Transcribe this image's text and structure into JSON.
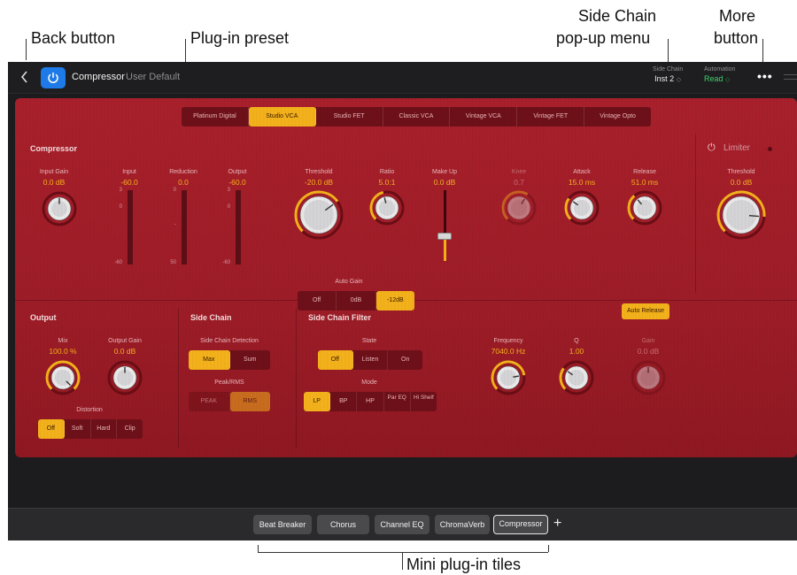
{
  "callouts": {
    "back": "Back button",
    "preset": "Plug-in preset",
    "sidechain_line1": "Side Chain",
    "sidechain_line2": "pop-up menu",
    "more_line1": "More",
    "more_line2": "button",
    "tiles": "Mini plug-in tiles"
  },
  "header": {
    "back_icon": "chevron-left-icon",
    "plugin_name": "Compressor",
    "preset_name": "User Default",
    "side_chain_label": "Side Chain",
    "side_chain_value": "Inst 2",
    "automation_label": "Automation",
    "automation_value": "Read",
    "more_icon": "•••"
  },
  "circuits": [
    "Platinum Digital",
    "Studio VCA",
    "Studio FET",
    "Classic VCA",
    "Vintage VCA",
    "Vintage FET",
    "Vintage Opto"
  ],
  "active_circuit": "Studio VCA",
  "compressor": {
    "title": "Compressor",
    "input_gain": {
      "label": "Input Gain",
      "value": "0.0 dB"
    },
    "input_meter": {
      "label": "Input",
      "value": "-60.0",
      "scale": [
        "3",
        "0",
        "-60"
      ]
    },
    "reduction_meter": {
      "label": "Reduction",
      "value": "0.0",
      "scale": [
        "0",
        "-",
        "50"
      ]
    },
    "output_meter": {
      "label": "Output",
      "value": "-60.0",
      "scale": [
        "3",
        "0",
        "-60"
      ]
    },
    "threshold": {
      "label": "Threshold",
      "value": "-20.0 dB"
    },
    "ratio": {
      "label": "Ratio",
      "value": "5.0:1"
    },
    "makeup": {
      "label": "Make Up",
      "value": "0.0 dB"
    },
    "knee": {
      "label": "Knee",
      "value": "0.7"
    },
    "attack": {
      "label": "Attack",
      "value": "15.0 ms"
    },
    "release": {
      "label": "Release",
      "value": "51.0 ms"
    },
    "auto_release": "Auto Release",
    "auto_gain": {
      "label": "Auto Gain",
      "options": [
        "Off",
        "0dB",
        "-12dB"
      ],
      "active": "-12dB"
    }
  },
  "limiter": {
    "label": "Limiter",
    "threshold": {
      "label": "Threshold",
      "value": "0.0 dB"
    }
  },
  "output": {
    "title": "Output",
    "mix": {
      "label": "Mix",
      "value": "100.0 %"
    },
    "output_gain": {
      "label": "Output Gain",
      "value": "0.0 dB"
    },
    "distortion": {
      "label": "Distortion",
      "options": [
        "Off",
        "Soft",
        "Hard",
        "Clip"
      ],
      "active": "Off"
    }
  },
  "side_chain": {
    "title": "Side Chain",
    "detection": {
      "label": "Side Chain Detection",
      "options": [
        "Max",
        "Sum"
      ],
      "active": "Max"
    },
    "peak_rms": {
      "label": "Peak/RMS",
      "options": [
        "PEAK",
        "RMS"
      ],
      "active": "RMS"
    }
  },
  "sc_filter": {
    "title": "Side Chain Filter",
    "state": {
      "label": "State",
      "options": [
        "Off",
        "Listen",
        "On"
      ],
      "active": "Off"
    },
    "mode": {
      "label": "Mode",
      "options": [
        "LP",
        "BP",
        "HP",
        "Par EQ",
        "Hi Shelf"
      ],
      "active": "LP"
    },
    "frequency": {
      "label": "Frequency",
      "value": "7040.0 Hz"
    },
    "q": {
      "label": "Q",
      "value": "1.00"
    },
    "gain": {
      "label": "Gain",
      "value": "0.0 dB"
    }
  },
  "tiles": [
    "Beat Breaker",
    "Chorus",
    "Channel EQ",
    "ChromaVerb",
    "Compressor"
  ],
  "active_tile": "Compressor",
  "colors": {
    "accent": "#f3b11b",
    "panel": "#a8202b",
    "power_blue": "#1e7ae6",
    "automation_green": "#3fd16a"
  }
}
